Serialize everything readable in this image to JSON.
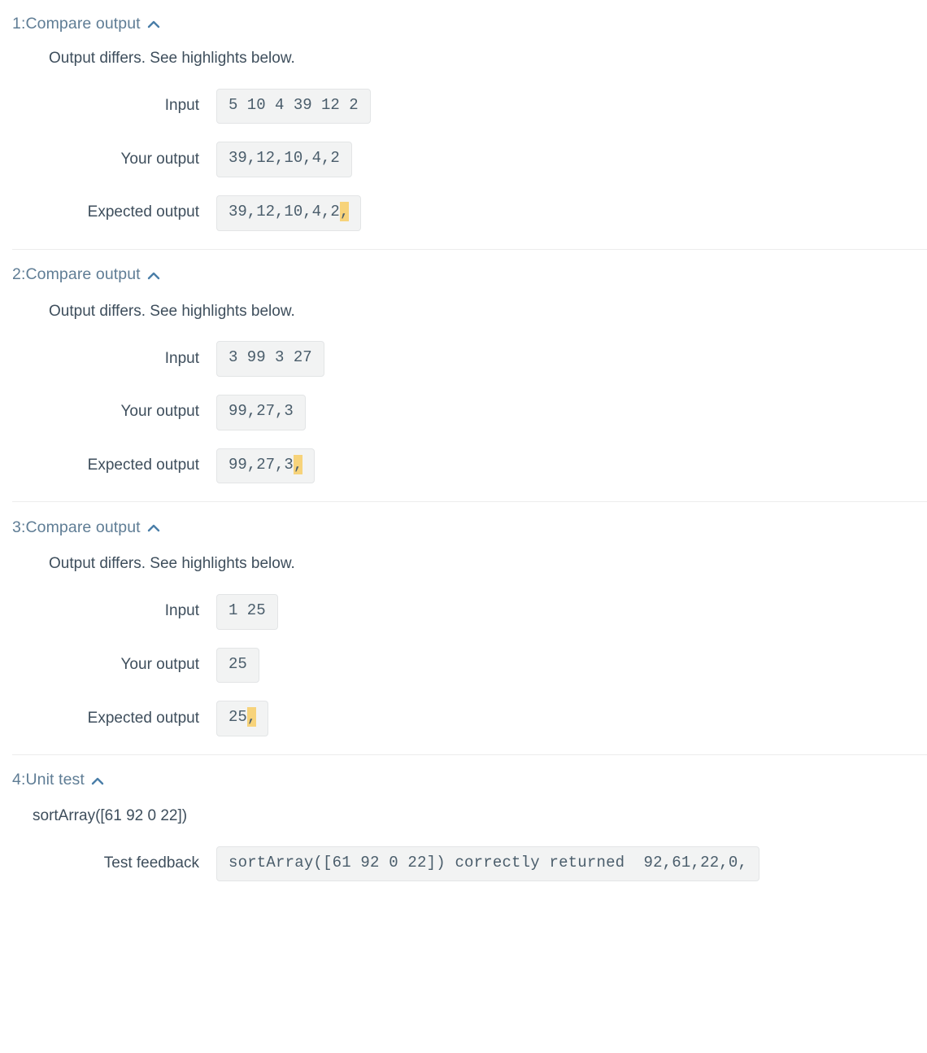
{
  "colors": {
    "header_text": "#5f7d95",
    "body_text": "#3e4e5c",
    "box_background": "#f2f3f3",
    "box_border": "#e3e5e6",
    "highlight": "#f7d37a",
    "divider": "#ececec",
    "mono_text": "#4a5d6b"
  },
  "labels": {
    "input": "Input",
    "your_output": "Your output",
    "expected_output": "Expected output",
    "test_feedback": "Test feedback"
  },
  "icons": {
    "collapse": "chevron-up-icon"
  },
  "sections": [
    {
      "id": "1",
      "title": "1:Compare output",
      "message": "Output differs. See highlights below.",
      "input": "5 10 4 39 12 2",
      "your_output": "39,12,10,4,2",
      "expected_output_text": "39,12,10,4,2",
      "expected_output_highlight": ","
    },
    {
      "id": "2",
      "title": "2:Compare output",
      "message": "Output differs. See highlights below.",
      "input": "3 99 3 27",
      "your_output": "99,27,3",
      "expected_output_text": "99,27,3",
      "expected_output_highlight": ","
    },
    {
      "id": "3",
      "title": "3:Compare output",
      "message": "Output differs. See highlights below.",
      "input": "1 25",
      "your_output": "25",
      "expected_output_text": "25",
      "expected_output_highlight": ","
    }
  ],
  "unit_test": {
    "title": "4:Unit test",
    "call": "sortArray([61 92 0 22])",
    "feedback": "sortArray([61 92 0 22]) correctly returned  92,61,22,0,"
  }
}
